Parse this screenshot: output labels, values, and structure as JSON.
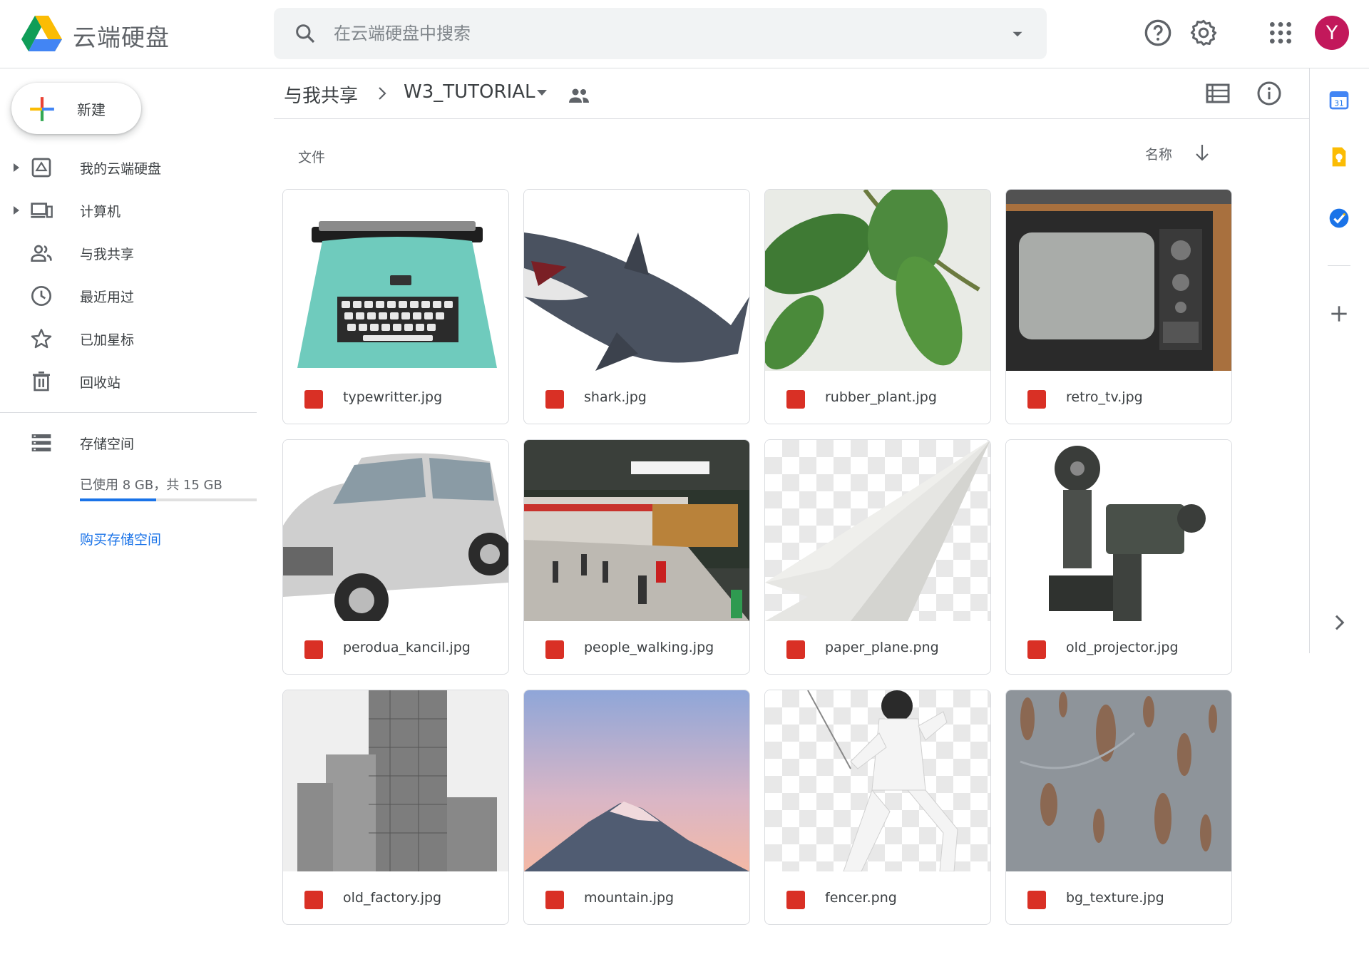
{
  "app": {
    "title": "云端硬盘"
  },
  "search": {
    "placeholder": "在云端硬盘中搜索"
  },
  "user": {
    "avatar_letter": "Y",
    "avatar_color": "#c2185b"
  },
  "sidebar": {
    "new_label": "新建",
    "items": [
      {
        "label": "我的云端硬盘",
        "icon": "drive-icon"
      },
      {
        "label": "计算机",
        "icon": "computer-icon"
      },
      {
        "label": "与我共享",
        "icon": "people-icon"
      },
      {
        "label": "最近用过",
        "icon": "clock-icon"
      },
      {
        "label": "已加星标",
        "icon": "star-icon"
      },
      {
        "label": "回收站",
        "icon": "trash-icon"
      }
    ],
    "storage": {
      "label": "存储空间",
      "usage_text": "已使用 8 GB，共 15 GB",
      "used_fraction": 0.43,
      "buy_label": "购买存储空间"
    }
  },
  "breadcrumb": {
    "parent": "与我共享",
    "current": "W3_TUTORIAL"
  },
  "content": {
    "section_label": "文件",
    "sort_label": "名称"
  },
  "files": [
    {
      "name": "typewritter.jpg"
    },
    {
      "name": "shark.jpg"
    },
    {
      "name": "rubber_plant.jpg"
    },
    {
      "name": "retro_tv.jpg"
    },
    {
      "name": "perodua_kancil.jpg"
    },
    {
      "name": "people_walking.jpg"
    },
    {
      "name": "paper_plane.png"
    },
    {
      "name": "old_projector.jpg"
    },
    {
      "name": "old_factory.jpg"
    },
    {
      "name": "mountain.jpg"
    },
    {
      "name": "fencer.png"
    },
    {
      "name": "bg_texture.jpg"
    }
  ],
  "colors": {
    "accent": "#1a73e8",
    "image_file_icon": "#d93025"
  }
}
